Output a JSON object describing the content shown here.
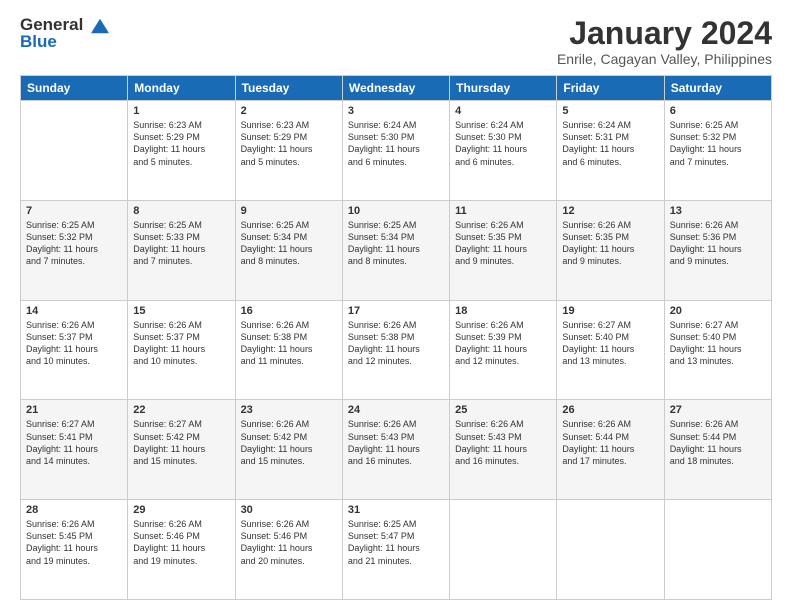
{
  "header": {
    "logo_line1": "General",
    "logo_line2": "Blue",
    "month_title": "January 2024",
    "location": "Enrile, Cagayan Valley, Philippines"
  },
  "weekdays": [
    "Sunday",
    "Monday",
    "Tuesday",
    "Wednesday",
    "Thursday",
    "Friday",
    "Saturday"
  ],
  "weeks": [
    [
      {
        "num": "",
        "info": ""
      },
      {
        "num": "1",
        "info": "Sunrise: 6:23 AM\nSunset: 5:29 PM\nDaylight: 11 hours\nand 5 minutes."
      },
      {
        "num": "2",
        "info": "Sunrise: 6:23 AM\nSunset: 5:29 PM\nDaylight: 11 hours\nand 5 minutes."
      },
      {
        "num": "3",
        "info": "Sunrise: 6:24 AM\nSunset: 5:30 PM\nDaylight: 11 hours\nand 6 minutes."
      },
      {
        "num": "4",
        "info": "Sunrise: 6:24 AM\nSunset: 5:30 PM\nDaylight: 11 hours\nand 6 minutes."
      },
      {
        "num": "5",
        "info": "Sunrise: 6:24 AM\nSunset: 5:31 PM\nDaylight: 11 hours\nand 6 minutes."
      },
      {
        "num": "6",
        "info": "Sunrise: 6:25 AM\nSunset: 5:32 PM\nDaylight: 11 hours\nand 7 minutes."
      }
    ],
    [
      {
        "num": "7",
        "info": "Sunrise: 6:25 AM\nSunset: 5:32 PM\nDaylight: 11 hours\nand 7 minutes."
      },
      {
        "num": "8",
        "info": "Sunrise: 6:25 AM\nSunset: 5:33 PM\nDaylight: 11 hours\nand 7 minutes."
      },
      {
        "num": "9",
        "info": "Sunrise: 6:25 AM\nSunset: 5:34 PM\nDaylight: 11 hours\nand 8 minutes."
      },
      {
        "num": "10",
        "info": "Sunrise: 6:25 AM\nSunset: 5:34 PM\nDaylight: 11 hours\nand 8 minutes."
      },
      {
        "num": "11",
        "info": "Sunrise: 6:26 AM\nSunset: 5:35 PM\nDaylight: 11 hours\nand 9 minutes."
      },
      {
        "num": "12",
        "info": "Sunrise: 6:26 AM\nSunset: 5:35 PM\nDaylight: 11 hours\nand 9 minutes."
      },
      {
        "num": "13",
        "info": "Sunrise: 6:26 AM\nSunset: 5:36 PM\nDaylight: 11 hours\nand 9 minutes."
      }
    ],
    [
      {
        "num": "14",
        "info": "Sunrise: 6:26 AM\nSunset: 5:37 PM\nDaylight: 11 hours\nand 10 minutes."
      },
      {
        "num": "15",
        "info": "Sunrise: 6:26 AM\nSunset: 5:37 PM\nDaylight: 11 hours\nand 10 minutes."
      },
      {
        "num": "16",
        "info": "Sunrise: 6:26 AM\nSunset: 5:38 PM\nDaylight: 11 hours\nand 11 minutes."
      },
      {
        "num": "17",
        "info": "Sunrise: 6:26 AM\nSunset: 5:38 PM\nDaylight: 11 hours\nand 12 minutes."
      },
      {
        "num": "18",
        "info": "Sunrise: 6:26 AM\nSunset: 5:39 PM\nDaylight: 11 hours\nand 12 minutes."
      },
      {
        "num": "19",
        "info": "Sunrise: 6:27 AM\nSunset: 5:40 PM\nDaylight: 11 hours\nand 13 minutes."
      },
      {
        "num": "20",
        "info": "Sunrise: 6:27 AM\nSunset: 5:40 PM\nDaylight: 11 hours\nand 13 minutes."
      }
    ],
    [
      {
        "num": "21",
        "info": "Sunrise: 6:27 AM\nSunset: 5:41 PM\nDaylight: 11 hours\nand 14 minutes."
      },
      {
        "num": "22",
        "info": "Sunrise: 6:27 AM\nSunset: 5:42 PM\nDaylight: 11 hours\nand 15 minutes."
      },
      {
        "num": "23",
        "info": "Sunrise: 6:26 AM\nSunset: 5:42 PM\nDaylight: 11 hours\nand 15 minutes."
      },
      {
        "num": "24",
        "info": "Sunrise: 6:26 AM\nSunset: 5:43 PM\nDaylight: 11 hours\nand 16 minutes."
      },
      {
        "num": "25",
        "info": "Sunrise: 6:26 AM\nSunset: 5:43 PM\nDaylight: 11 hours\nand 16 minutes."
      },
      {
        "num": "26",
        "info": "Sunrise: 6:26 AM\nSunset: 5:44 PM\nDaylight: 11 hours\nand 17 minutes."
      },
      {
        "num": "27",
        "info": "Sunrise: 6:26 AM\nSunset: 5:44 PM\nDaylight: 11 hours\nand 18 minutes."
      }
    ],
    [
      {
        "num": "28",
        "info": "Sunrise: 6:26 AM\nSunset: 5:45 PM\nDaylight: 11 hours\nand 19 minutes."
      },
      {
        "num": "29",
        "info": "Sunrise: 6:26 AM\nSunset: 5:46 PM\nDaylight: 11 hours\nand 19 minutes."
      },
      {
        "num": "30",
        "info": "Sunrise: 6:26 AM\nSunset: 5:46 PM\nDaylight: 11 hours\nand 20 minutes."
      },
      {
        "num": "31",
        "info": "Sunrise: 6:25 AM\nSunset: 5:47 PM\nDaylight: 11 hours\nand 21 minutes."
      },
      {
        "num": "",
        "info": ""
      },
      {
        "num": "",
        "info": ""
      },
      {
        "num": "",
        "info": ""
      }
    ]
  ]
}
